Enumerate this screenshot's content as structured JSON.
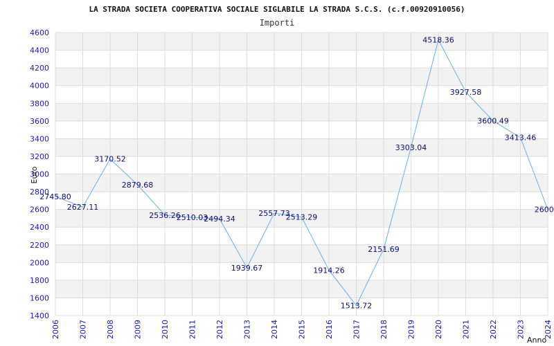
{
  "chart_data": {
    "type": "line",
    "title": "LA STRADA SOCIETA COOPERATIVA SOCIALE SIGLABILE LA STRADA S.C.S. (c.f.00920910056)",
    "subtitle": "Importi",
    "xlabel": "Anno",
    "ylabel": "Euro",
    "ylim": [
      1400,
      4600
    ],
    "y_ticks": [
      1400,
      1600,
      1800,
      2000,
      2200,
      2400,
      2600,
      2800,
      3000,
      3200,
      3400,
      3600,
      3800,
      4000,
      4200,
      4400,
      4600
    ],
    "x": [
      2006,
      2007,
      2008,
      2009,
      2010,
      2011,
      2012,
      2013,
      2014,
      2015,
      2016,
      2017,
      2018,
      2019,
      2020,
      2021,
      2022,
      2023,
      2024
    ],
    "values": [
      2745.8,
      2627.11,
      3170.52,
      2879.68,
      2536.26,
      2510.03,
      2494.34,
      1939.67,
      2557.73,
      2513.29,
      1914.26,
      1513.72,
      2151.69,
      3303.04,
      4518.36,
      3927.58,
      3600.49,
      3413.46,
      2600.0
    ],
    "data_labels": [
      "2745.80",
      "2627.11",
      "3170.52",
      "2879.68",
      "2536.26",
      "2510.03",
      "2494.34",
      "1939.67",
      "2557.73",
      "2513.29",
      "1914.26",
      "1513.72",
      "2151.69",
      "3303.04",
      "4518.36",
      "3927.58",
      "3600.49",
      "3413.46",
      "2600.0"
    ],
    "grid": true,
    "band_colors": [
      "#f2f2f2",
      "#ffffff"
    ],
    "line_color": "#6aaee8",
    "tick_color": "#1a1aa6",
    "label_color": "#0d0d6b"
  }
}
